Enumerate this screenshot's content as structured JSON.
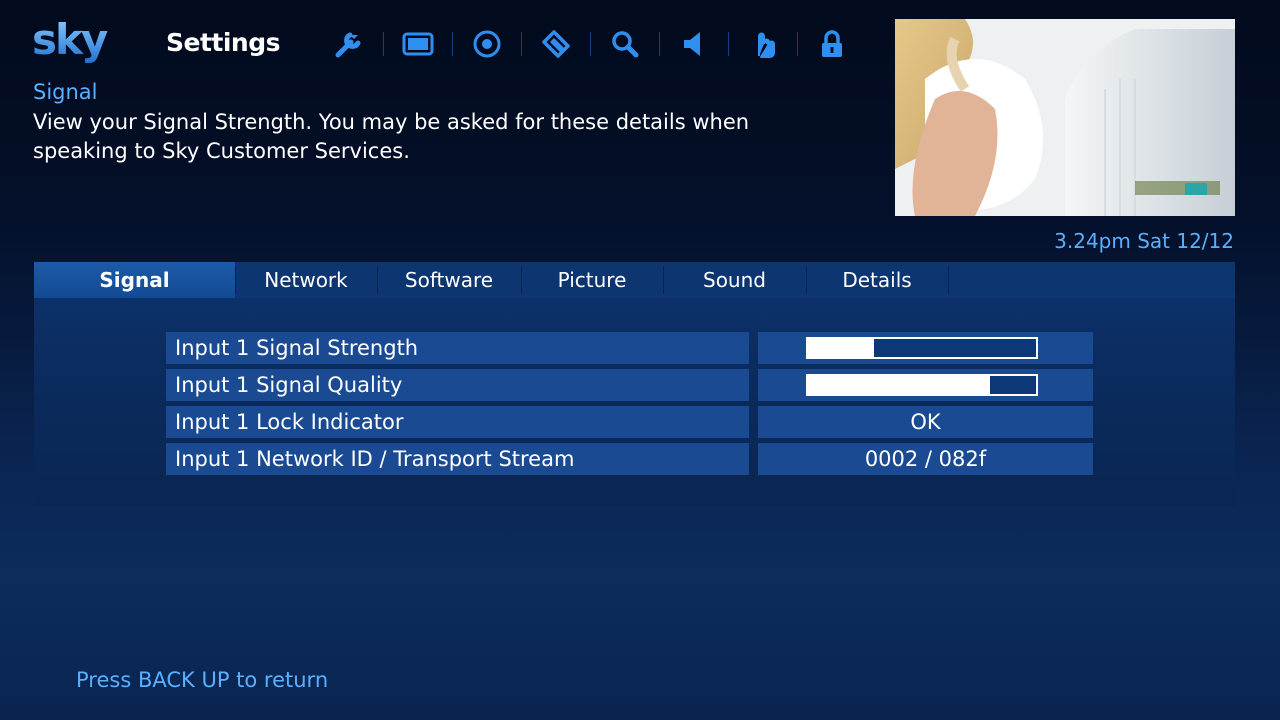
{
  "brand": {
    "logo_text": "sky"
  },
  "header": {
    "title": "Settings",
    "icons": [
      "wrench-icon",
      "tv-screen-icon",
      "record-disc-icon",
      "tag-icon",
      "search-icon",
      "speaker-icon",
      "touch-hand-icon",
      "lock-icon"
    ]
  },
  "section": {
    "name": "Signal",
    "description": "View your Signal Strength. You may be asked for these details when speaking to Sky Customer Services."
  },
  "clock": "3.24pm Sat 12/12",
  "tabs": [
    "Signal",
    "Network",
    "Software",
    "Picture",
    "Sound",
    "Details"
  ],
  "active_tab": "Signal",
  "rows": [
    {
      "label": "Input 1 Signal Strength",
      "meter_level": 0.29
    },
    {
      "label": "Input 1 Signal Quality",
      "meter_level": 0.8
    },
    {
      "label": "Input 1 Lock Indicator",
      "value": "OK"
    },
    {
      "label": "Input 1 Network ID / Transport Stream",
      "value": "0002 / 082f"
    }
  ],
  "footer": {
    "hint": "Press BACK UP to return"
  },
  "colors": {
    "accent_text": "#5ab0ff",
    "icon": "#2f8ff0",
    "row_background": "#1a4a92",
    "meter_track": "#0d3878",
    "meter_fill": "#ffffff"
  }
}
